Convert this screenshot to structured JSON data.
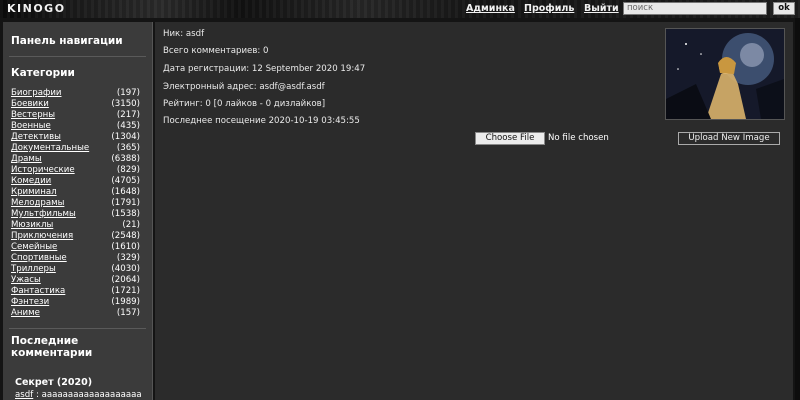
{
  "header": {
    "logo": "KINOGO",
    "nav": [
      "Админка",
      "Профиль",
      "Выйти"
    ],
    "search_placeholder": "поиск",
    "search_button": "ok"
  },
  "sidebar": {
    "nav_title": "Панель навигации",
    "categories_title": "Категории",
    "categories": [
      {
        "name": "Биографии",
        "count": "(197)"
      },
      {
        "name": "Боевики",
        "count": "(3150)"
      },
      {
        "name": "Вестерны",
        "count": "(217)"
      },
      {
        "name": "Военные",
        "count": "(435)"
      },
      {
        "name": "Детективы",
        "count": "(1304)"
      },
      {
        "name": "Документальные",
        "count": "(365)"
      },
      {
        "name": "Драмы",
        "count": "(6388)"
      },
      {
        "name": "Исторические",
        "count": "(829)"
      },
      {
        "name": "Комедии",
        "count": "(4705)"
      },
      {
        "name": "Криминал",
        "count": "(1648)"
      },
      {
        "name": "Мелодрамы",
        "count": "(1791)"
      },
      {
        "name": "Мультфильмы",
        "count": "(1538)"
      },
      {
        "name": "Мюзиклы",
        "count": "(21)"
      },
      {
        "name": "Приключения",
        "count": "(2548)"
      },
      {
        "name": "Семейные",
        "count": "(1610)"
      },
      {
        "name": "Спортивные",
        "count": "(329)"
      },
      {
        "name": "Триллеры",
        "count": "(4030)"
      },
      {
        "name": "Ужасы",
        "count": "(2064)"
      },
      {
        "name": "Фантастика",
        "count": "(1721)"
      },
      {
        "name": "Фэнтези",
        "count": "(1989)"
      },
      {
        "name": "Аниме",
        "count": "(157)"
      }
    ],
    "recent_title_line1": "Последние",
    "recent_title_line2": "комментарии",
    "recent_comment": {
      "movie": "Секрет (2020)",
      "user": "asdf",
      "separator": " : ",
      "text": "ааааааааааааааааааа"
    }
  },
  "profile": {
    "nick": "Ник: asdf",
    "comments": "Всего комментариев: 0",
    "registered": "Дата регистрации: 12 September 2020 19:47",
    "email": "Электронный адрес: asdf@asdf.asdf",
    "rating": "Рейтинг: 0 [0 лайков - 0 дизлайков]",
    "last_visit": "Последнее посещение 2020-10-19 03:45:55",
    "choose_file_label": "Choose File",
    "file_status": "No file chosen",
    "upload_label": "Upload New Image"
  }
}
